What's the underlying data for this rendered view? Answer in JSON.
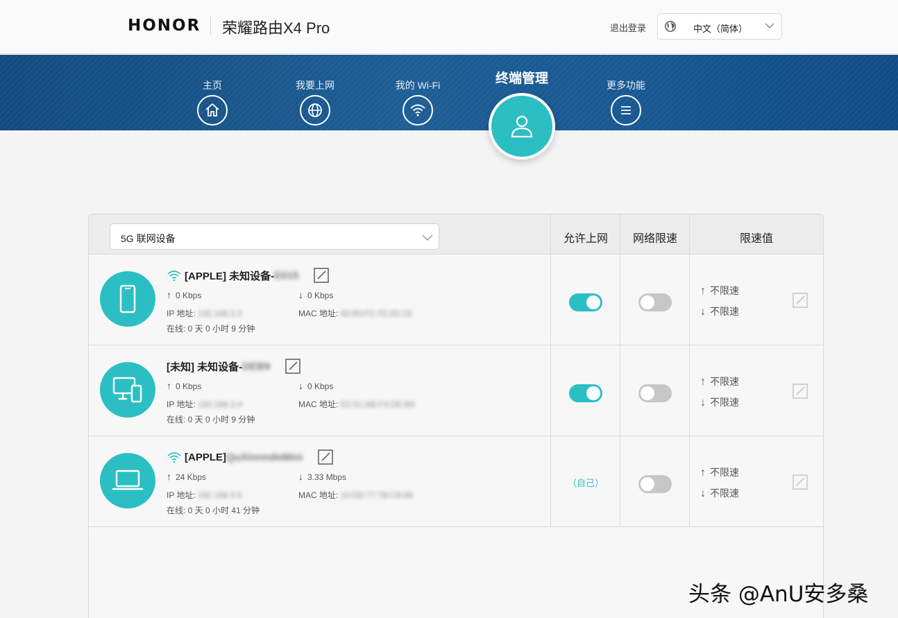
{
  "header": {
    "logo": "HONOR",
    "product": "荣耀路由X4 Pro",
    "logout": "退出登录",
    "language": "中文（简体）"
  },
  "nav": {
    "home": "主页",
    "internet": "我要上网",
    "wifi": "我的 Wi-Fi",
    "devices": "终端管理",
    "more": "更多功能"
  },
  "table": {
    "band_select": "5G 联网设备",
    "col_allow": "允许上网",
    "col_limit": "网络限速",
    "col_value": "限速值"
  },
  "devices": [
    {
      "name": "[APPLE] 未知设备-",
      "name_suffix": "E015",
      "up": "0 Kbps",
      "down": "0 Kbps",
      "ip_label": "IP 地址:",
      "ip": "192.168.3.3",
      "mac_label": "MAC 地址:",
      "mac": "62:B0:F2:7D:2D:19",
      "online": "在线: 0 天 0 小时 9 分钟",
      "allow": true,
      "limit": false,
      "up_limit": "不限速",
      "down_limit": "不限速"
    },
    {
      "name": "[未知] 未知设备-",
      "name_suffix": "DEB9",
      "up": "0 Kbps",
      "down": "0 Kbps",
      "ip_label": "IP 地址:",
      "ip": "192.168.3.4",
      "mac_label": "MAC 地址:",
      "mac": "D2:51:AB:F4:DE:B9",
      "online": "在线: 0 天 0 小时 9 分钟",
      "allow": true,
      "limit": false,
      "up_limit": "不限速",
      "down_limit": "不限速"
    },
    {
      "name": "[APPLE] ",
      "name_suffix": "QuXinnndeMini",
      "up": "24 Kbps",
      "down": "3.33 Mbps",
      "ip_label": "IP 地址:",
      "ip": "192.168.3.5",
      "mac_label": "MAC 地址:",
      "mac": "10:DD:77:7B:C8:88",
      "online": "在线: 0 天 0 小时 41 分钟",
      "allow_text": "（自己）",
      "limit": false,
      "up_limit": "不限速",
      "down_limit": "不限速"
    }
  ],
  "arrows": {
    "up": "↑",
    "down": "↓"
  },
  "watermark": "头条 @AnU安多桑",
  "colors": {
    "accent": "#2bbfc4",
    "nav_bg": "#1a5a92",
    "toggle_off": "#c6c6c6"
  }
}
